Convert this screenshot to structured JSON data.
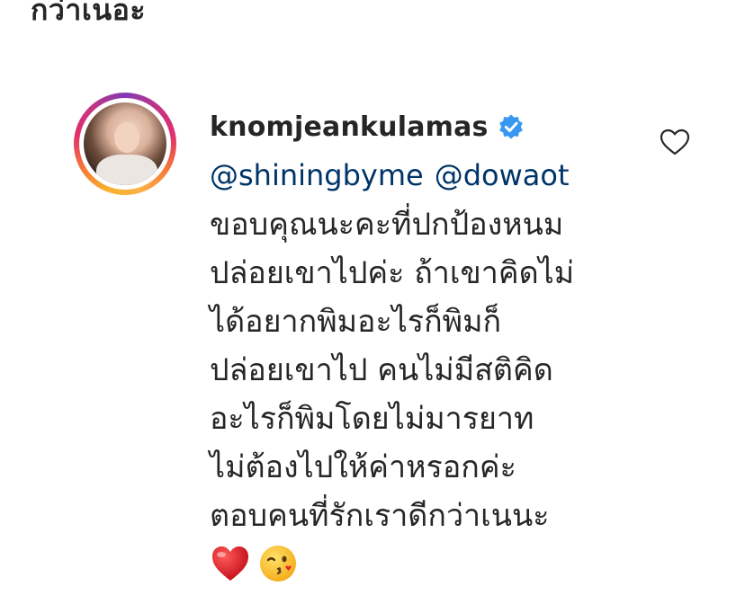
{
  "top_snippet": "กว่าเนอะ",
  "comment": {
    "username": "knomjeankulamas",
    "verified": true,
    "mentions": [
      "@shiningbyme",
      "@dowaot"
    ],
    "lines": [
      "ขอบคุณนะคะที่ปกป้องหนม",
      "ปล่อยเขาไปค่ะ ถ้าเขาคิดไม่",
      "ได้อยากพิมอะไรก็พิมก็",
      "ปล่อยเขาไป คนไม่มีสติคิด",
      "อะไรก็พิมโดยไม่มารยาท",
      "ไม่ต้องไปให้ค่าหรอกค่ะ",
      "ตอบคนที่รักเราดีกว่าเนนะ"
    ],
    "emojis": [
      "red-heart",
      "kissing-wink-face"
    ]
  },
  "colors": {
    "text": "#262626",
    "mention": "#003569",
    "verified": "#3897f0",
    "heart": "#ed4956"
  },
  "icons": {
    "like": "heart-outline-icon",
    "verified": "verified-badge-icon"
  }
}
